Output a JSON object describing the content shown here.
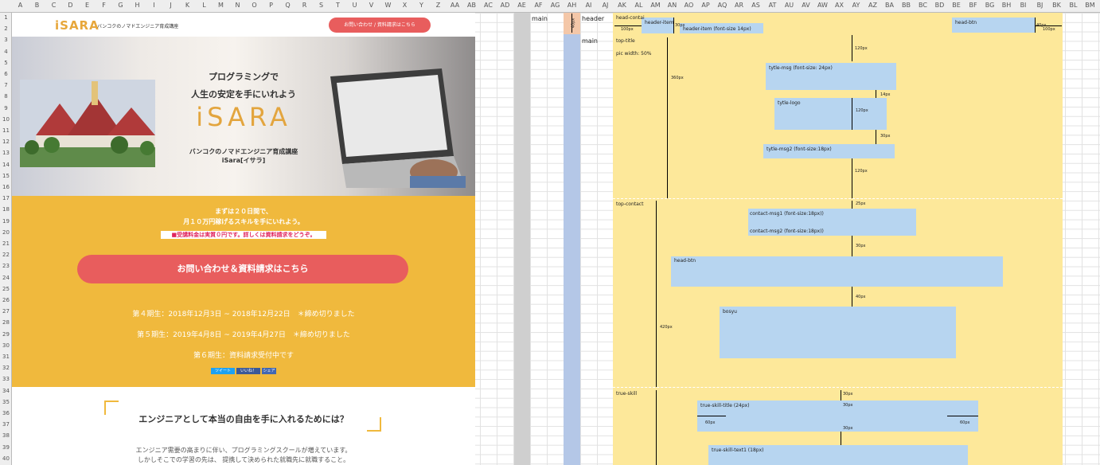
{
  "spreadsheet": {
    "columns": [
      "A",
      "B",
      "C",
      "D",
      "E",
      "F",
      "G",
      "H",
      "I",
      "J",
      "K",
      "L",
      "M",
      "N",
      "O",
      "P",
      "Q",
      "R",
      "S",
      "T",
      "U",
      "V",
      "W",
      "X",
      "Y",
      "Z",
      "AA",
      "AB",
      "AC",
      "AD",
      "AE",
      "AF",
      "AG",
      "AH",
      "AI",
      "AJ",
      "AK",
      "AL",
      "AM",
      "AN",
      "AO",
      "AP",
      "AQ",
      "AR",
      "AS",
      "AT",
      "AU",
      "AV",
      "AW",
      "AX",
      "AY",
      "AZ",
      "BA",
      "BB",
      "BC",
      "BD",
      "BE",
      "BF",
      "BG",
      "BH",
      "BI",
      "BJ",
      "BK",
      "BL",
      "BM"
    ],
    "rows": [
      "1",
      "2",
      "3",
      "4",
      "5",
      "6",
      "7",
      "8",
      "9",
      "10",
      "11",
      "12",
      "13",
      "14",
      "15",
      "16",
      "17",
      "18",
      "19",
      "20",
      "21",
      "22",
      "23",
      "24",
      "25",
      "26",
      "27",
      "28",
      "29",
      "30",
      "31",
      "32",
      "33",
      "34",
      "35",
      "36",
      "37",
      "38",
      "39",
      "40"
    ],
    "labels": {
      "main_col_af": "main",
      "header_col_ai": "header",
      "main_col_ai": "main",
      "height_ah": "40px"
    }
  },
  "site": {
    "header": {
      "logo": "iSARA",
      "logo_sub": "バンコクのノマドエンジニア育成講座",
      "button": "お問い合わせ / 資料請求はこちら"
    },
    "hero": {
      "line1": "プログラミングで",
      "line2": "人生の安定を手にいれよう",
      "logo": "iSARA",
      "line3": "バンコクのノマドエンジニア育成講座",
      "line4": "iSara[イサラ]"
    },
    "cta": {
      "msg1": "まずは２０日間で、",
      "msg2": "月１０万円稼げるスキルを手にいれよう。",
      "notice": "■受講料金は実質０円です。詳しくは資料請求をどうぞ。",
      "button": "お問い合わせ＆資料請求はこちら",
      "term4": "第４期生：2018年12月3日 ~ 2018年12月22日　＊締め切りました",
      "term5": "第５期生：2019年4月8日 ~ 2019年4月27日　＊締め切りました",
      "term6": "第６期生：資料請求受付中です",
      "share": [
        "ツイート",
        "いいね！",
        "シェア"
      ]
    },
    "section": {
      "title": "エンジニアとして本当の自由を手に入れるためには？",
      "line1": "エンジニア需要の高まりに伴い、プログラミングスクールが増えています。",
      "line2": "しかしそこでの学習の先は、 提携して決められた就職先に就職すること。"
    }
  },
  "wireframe": {
    "head_contai": "head-contai",
    "w100": "100px",
    "header_item": "header-item",
    "header_item_font": "header-item (font-size 14px)",
    "h30": "30px",
    "head_btn": "head-btn",
    "h40": "40px",
    "w100b": "100px",
    "top_title": "top-title",
    "pic": "pic  width: 50%",
    "h360": "360px",
    "h120a": "120px",
    "tytle_msg": "tytle-msg (font-size: 24px)",
    "h14": "14px",
    "tytle_logo": "tytle-logo",
    "h120b": "120px",
    "h30b": "30px",
    "tytle_msg2": "tytle-msg2 (font-size:18px)",
    "h120c": "120px",
    "top_contact": "top-contact",
    "h25": "25px",
    "contact1": "contact-msg1 (font-size:18px))",
    "contact2": "contact-msg2 (font-size:18px))",
    "h30c": "30px",
    "head_btn2": "head-btn",
    "h420": "420px",
    "h40b": "40px",
    "bosyu": "bosyu",
    "true_skill": "true-skill",
    "h30d": "30px",
    "h30e": "30px",
    "skill_title": "true-skill-title  (24px)",
    "w60a": "60px",
    "w60b": "60px",
    "h30f": "30px",
    "skill_text": "true-skill-text1  (18px)"
  },
  "colors": {
    "accent_red": "#e85d5d",
    "yellow": "#f0b93d",
    "wire_yellow": "#fde89a",
    "wire_blue": "#b7d5f0"
  }
}
